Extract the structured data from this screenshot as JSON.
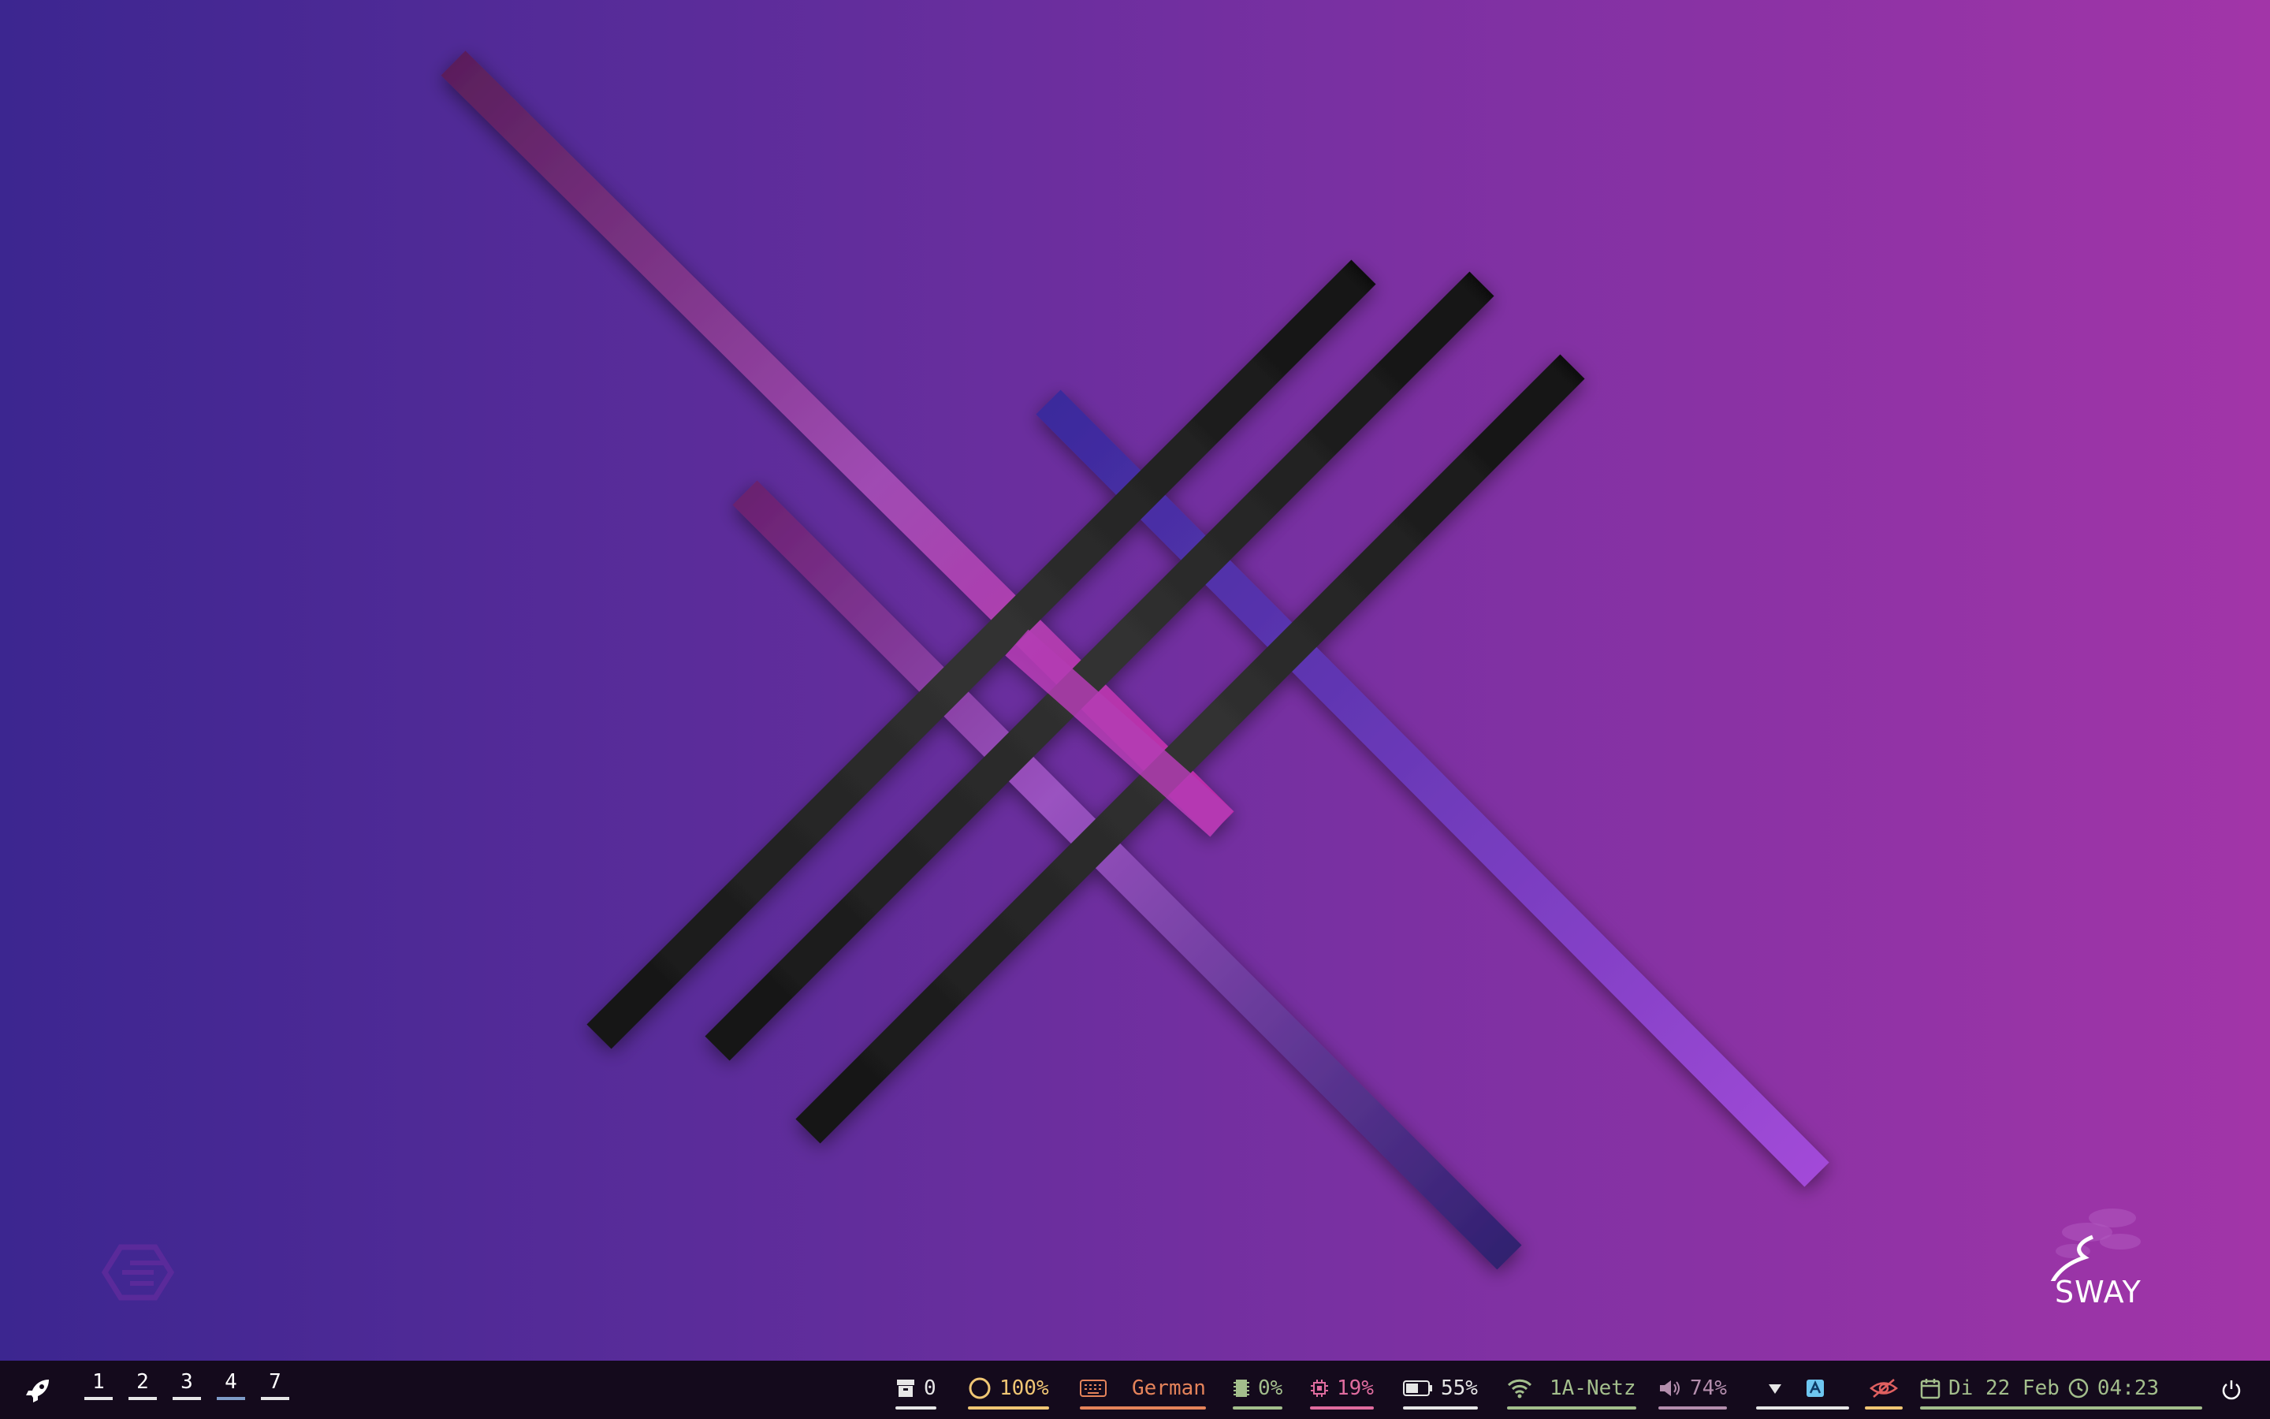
{
  "workspaces": [
    {
      "label": "1",
      "active": false
    },
    {
      "label": "2",
      "active": false
    },
    {
      "label": "3",
      "active": false
    },
    {
      "label": "4",
      "active": true
    },
    {
      "label": "7",
      "active": false
    }
  ],
  "status": {
    "archive": {
      "icon": "archive-icon",
      "value": "0",
      "color": "#e6e6e6"
    },
    "brightness": {
      "icon": "circle-icon",
      "value": "100%",
      "color": "#f0c674"
    },
    "keyboard": {
      "icon": "keyboard-icon",
      "value": "German",
      "color": "#e5835a"
    },
    "memory": {
      "icon": "memory-icon",
      "value": "0%",
      "color": "#a3be8c"
    },
    "cpu": {
      "icon": "cpu-icon",
      "value": "19%",
      "color": "#e06c9f"
    },
    "battery": {
      "icon": "battery-icon",
      "value": "55%",
      "color": "#e6e6e6"
    },
    "wifi": {
      "icon": "wifi-icon",
      "value": "1A-Netz",
      "color": "#a3be8c"
    },
    "volume": {
      "icon": "speaker-icon",
      "value": "74%",
      "color": "#b48ead"
    },
    "tray": {
      "icons": [
        "network-tray-icon",
        "app-tray-icon"
      ]
    },
    "idle": {
      "icon": "eye-off-icon",
      "color": "#f0c674"
    },
    "date": {
      "icon": "calendar-icon",
      "value": "Di 22 Feb",
      "color": "#a3be8c"
    },
    "clock": {
      "icon": "clock-icon",
      "value": "04:23",
      "color": "#a3be8c"
    }
  },
  "wallpaper": {
    "logo_text": "SWAY"
  }
}
